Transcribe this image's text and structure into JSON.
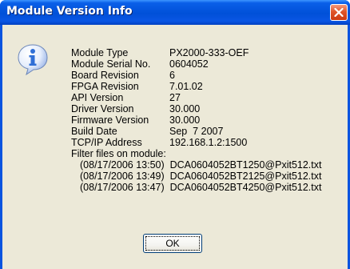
{
  "window": {
    "title": "Module Version Info"
  },
  "icon": {
    "name": "information-icon",
    "color": "#2f6fd6"
  },
  "info": [
    {
      "label": "Module Type",
      "value": "PX2000-333-OEF"
    },
    {
      "label": "Module Serial No.",
      "value": "0604052"
    },
    {
      "label": "Board Revision",
      "value": "6"
    },
    {
      "label": "FPGA Revision",
      "value": "7.01.02"
    },
    {
      "label": "API Version",
      "value": "27"
    },
    {
      "label": "Driver Version",
      "value": "30.000"
    },
    {
      "label": "Firmware Version",
      "value": "30.000"
    },
    {
      "label": "Build Date",
      "value": "Sep  7 2007"
    },
    {
      "label": "TCP/IP Address",
      "value": "192.168.1.2:1500"
    }
  ],
  "filters": {
    "heading": "Filter files on module:",
    "files": [
      "(08/17/2006 13:50)  DCA0604052BT1250@Pxit512.txt",
      "(08/17/2006 13:49)  DCA0604052BT2125@Pxit512.txt",
      "(08/17/2006 13:47)  DCA0604052BT4250@Pxit512.txt"
    ]
  },
  "buttons": {
    "ok": "OK"
  }
}
